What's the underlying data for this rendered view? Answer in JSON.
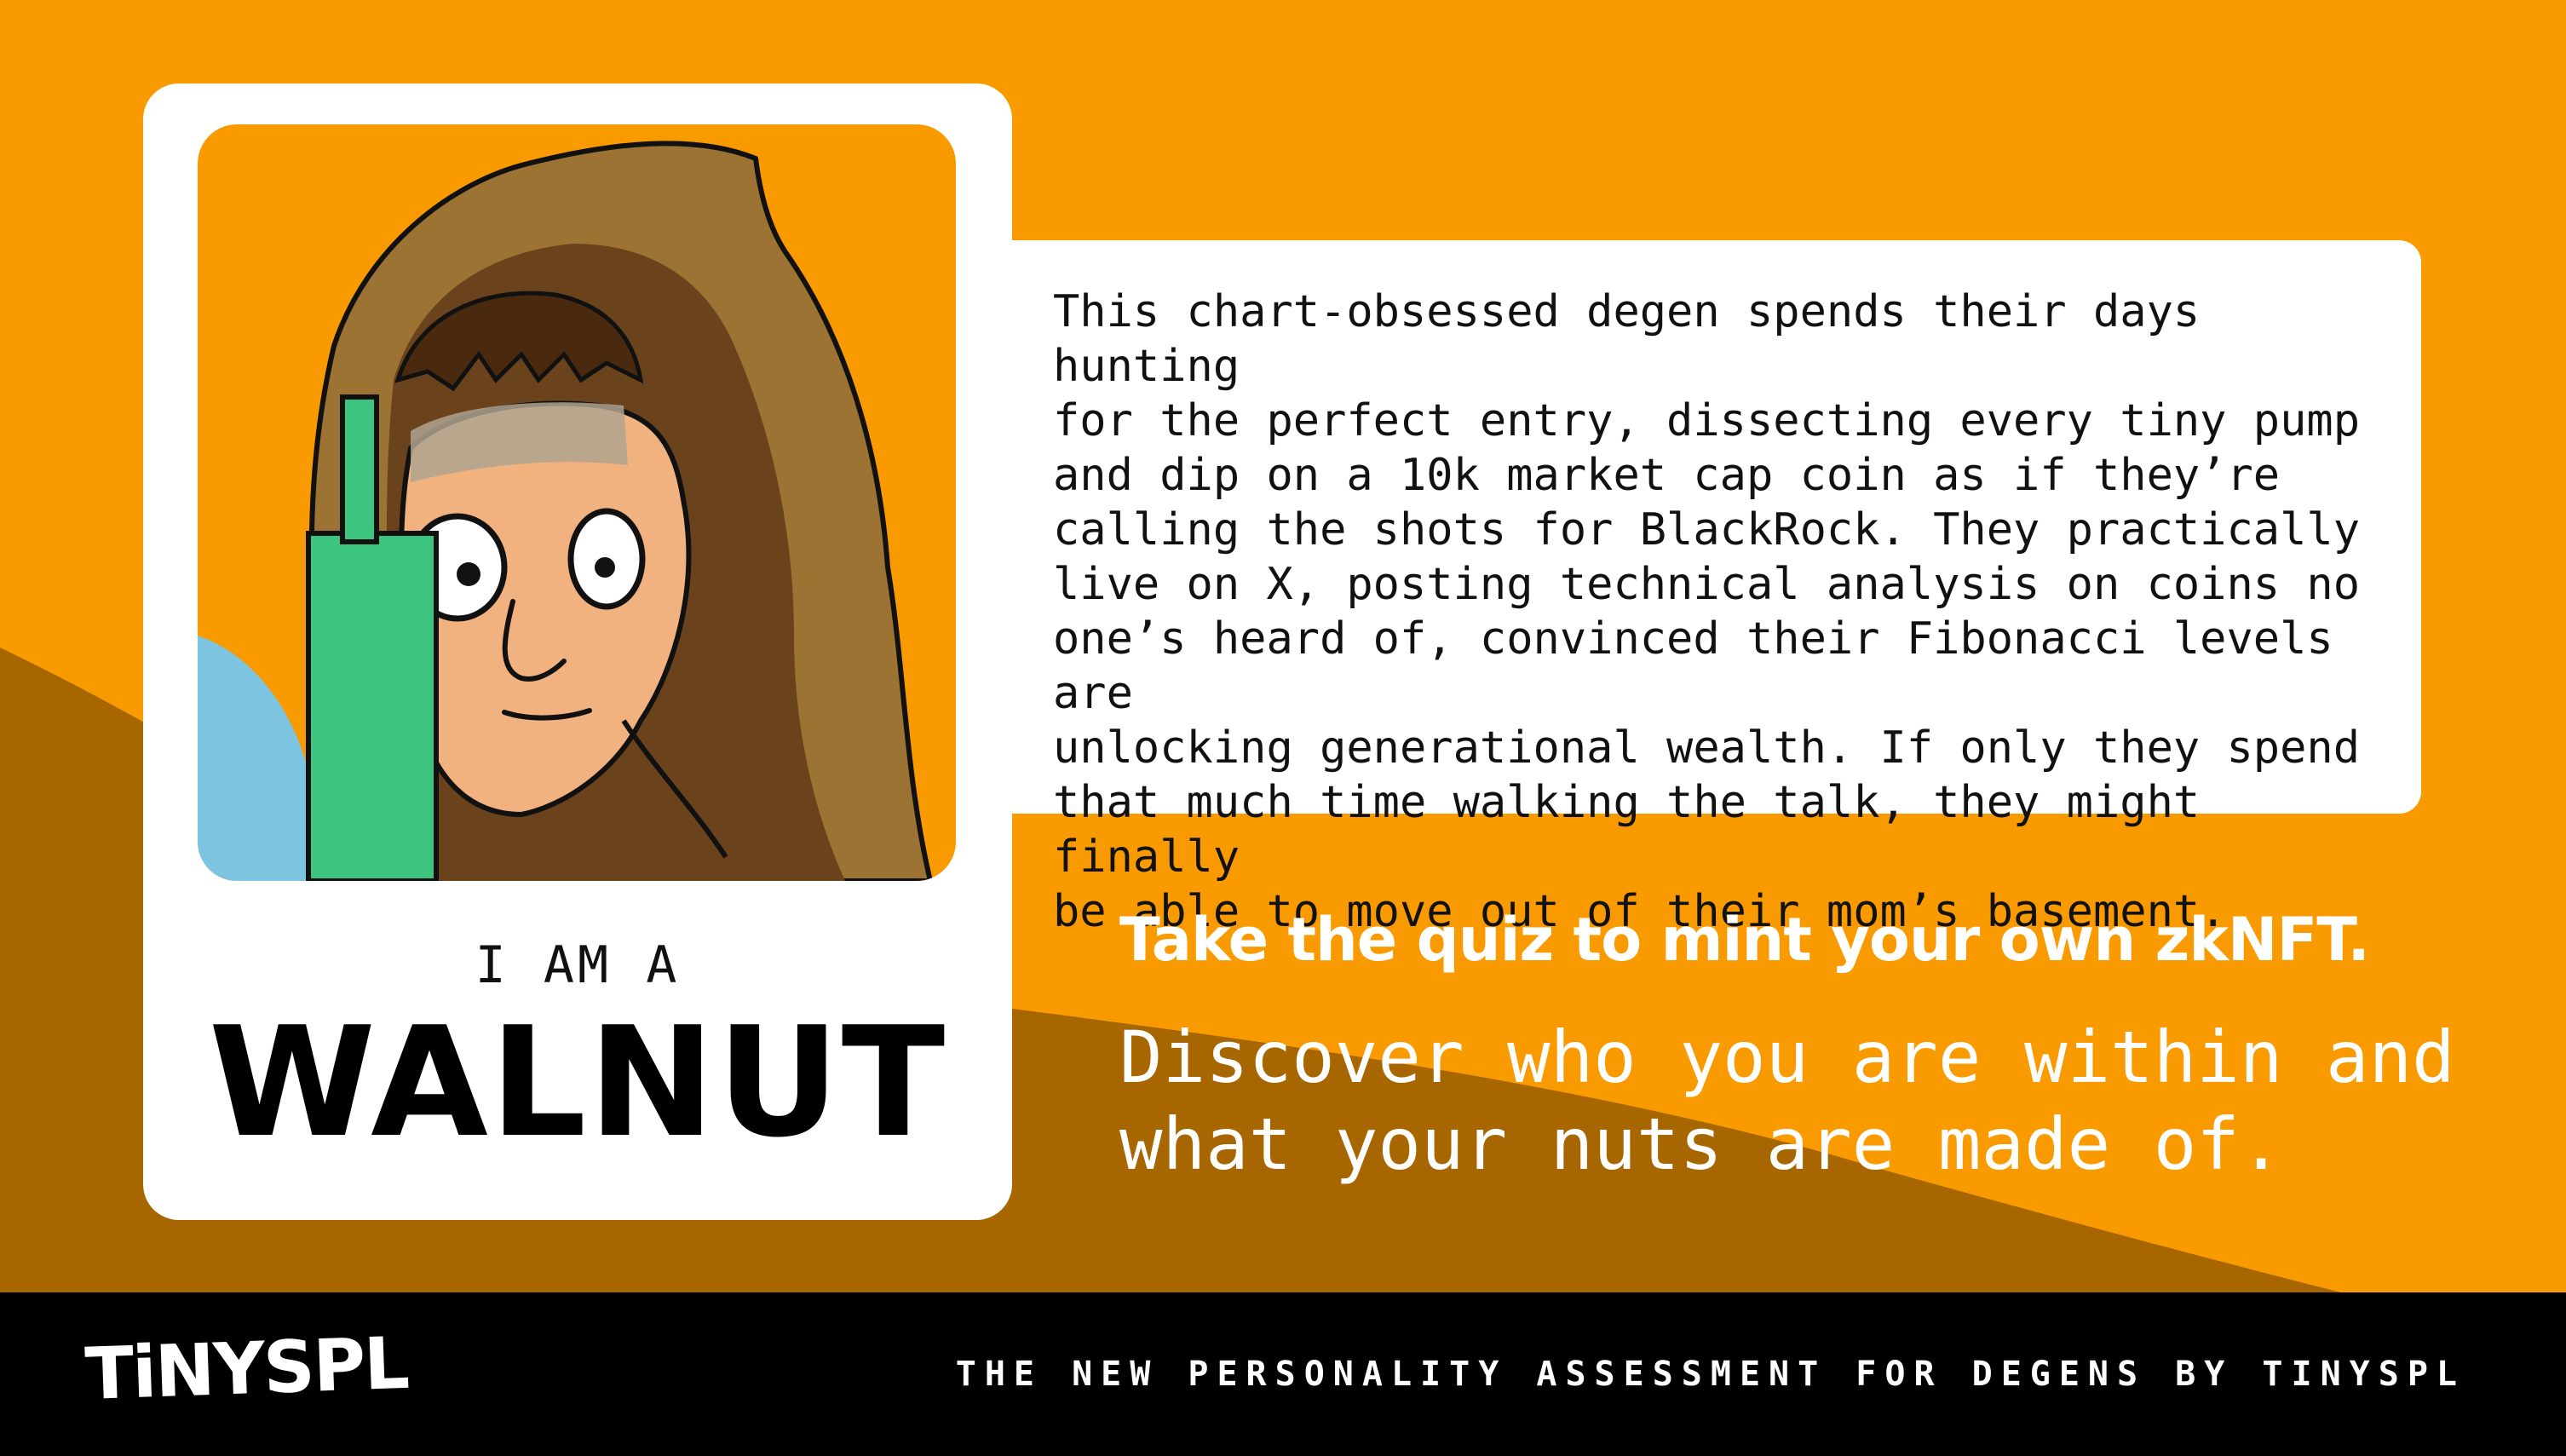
{
  "colors": {
    "background": "#F99B00",
    "wave": "#A86600",
    "card": "#FFFFFF",
    "footer": "#000000",
    "candle": "#3DC47E"
  },
  "card": {
    "portrait_icon": "hooded-degen-character",
    "label": "I AM A",
    "type_name": "WALNUT"
  },
  "description": "This chart-obsessed degen spends their days hunting\nfor the perfect entry, dissecting every tiny pump\nand dip on a 10k market cap coin as if they’re\ncalling the shots for BlackRock. They practically\nlive on X, posting technical analysis on coins no\none’s heard of, convinced their Fibonacci levels are\nunlocking generational wealth. If only they spend\nthat much time walking the talk, they might finally\nbe able to move out of their mom’s basement.",
  "cta": {
    "heading": "Take the quiz to mint your own zkNFT.",
    "subheading": "Discover who you are within and\nwhat your nuts are made of."
  },
  "footer": {
    "logo": "TiNYSPL",
    "tagline": "THE NEW PERSONALITY ASSESSMENT FOR DEGENS BY TINYSPL"
  }
}
